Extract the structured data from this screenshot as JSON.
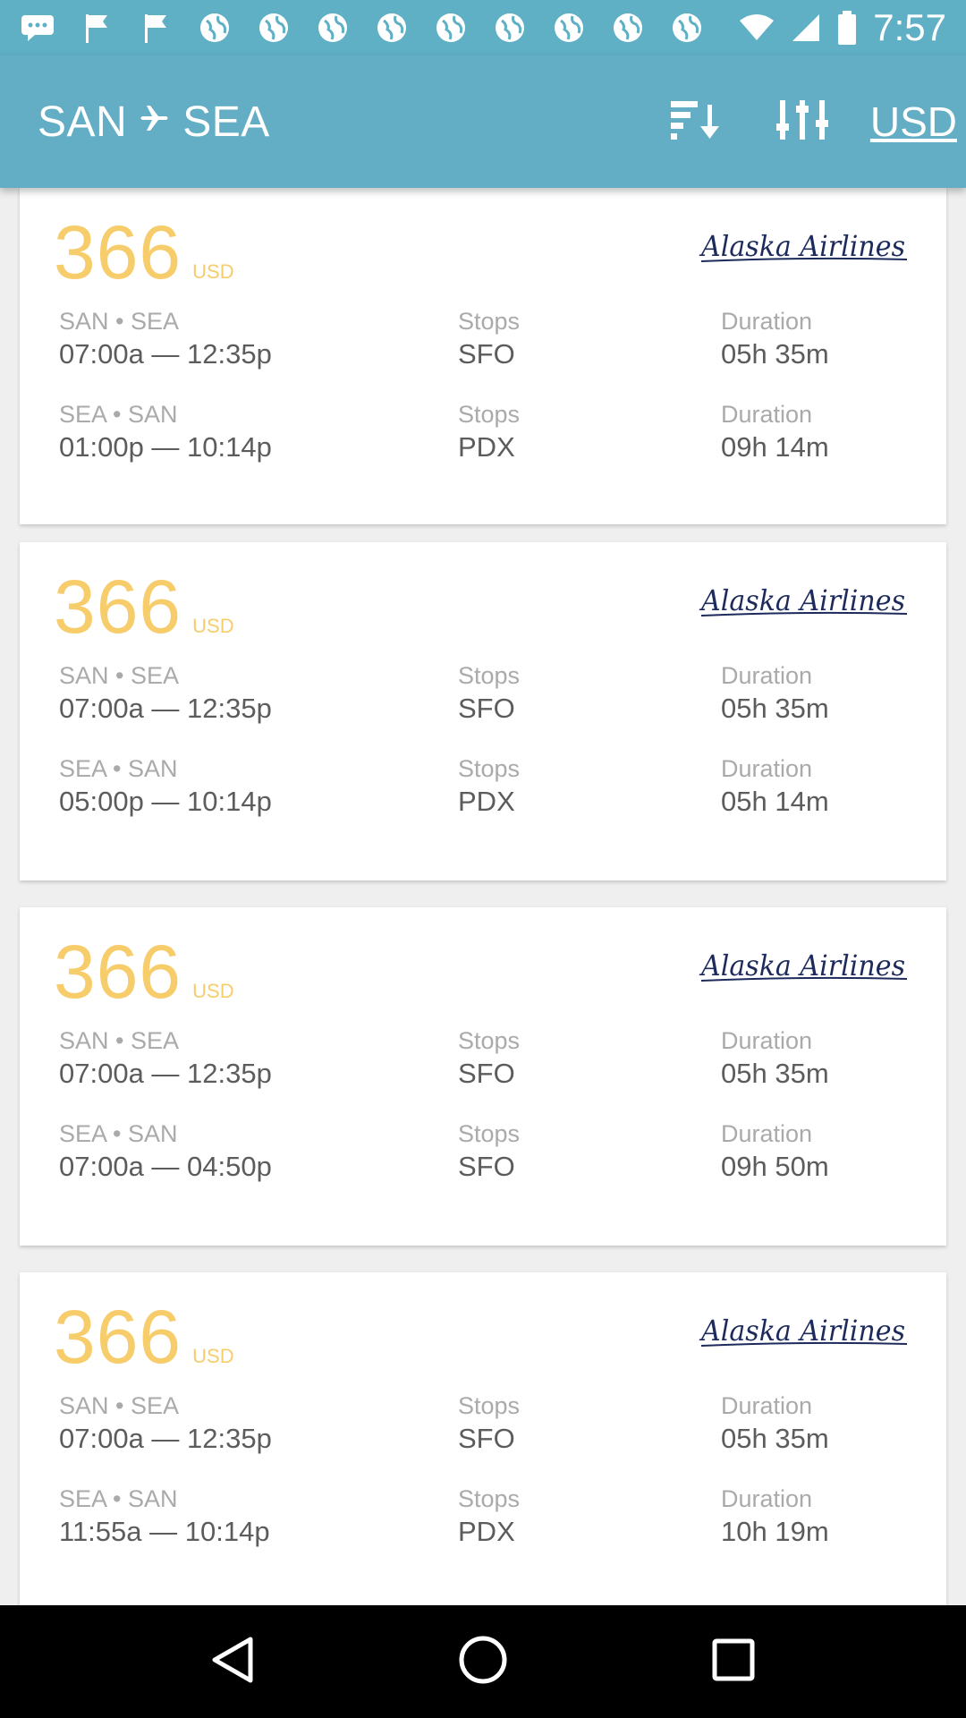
{
  "status_bar": {
    "time": "7:57",
    "notification_icons": [
      "chat-icon",
      "flag-icon",
      "flag-icon",
      "globe-icon",
      "globe-icon",
      "globe-icon",
      "globe-icon",
      "globe-icon",
      "globe-icon",
      "globe-icon",
      "globe-icon"
    ],
    "colors": {
      "background": "#5fb0c5"
    }
  },
  "header": {
    "origin": "SAN",
    "destination": "SEA",
    "sort_icon": "sort-icon",
    "filter_icon": "filter-icon",
    "currency": "USD",
    "colors": {
      "background": "#63aec4"
    }
  },
  "results": [
    {
      "price": "366",
      "currency": "USD",
      "airline": "Alaska Airlines",
      "outbound": {
        "route": "SAN • SEA",
        "times": "07:00a — 12:35p",
        "stops_label": "Stops",
        "stops": "SFO",
        "duration_label": "Duration",
        "duration": "05h 35m"
      },
      "return": {
        "route": "SEA • SAN",
        "times": "01:00p — 10:14p",
        "stops_label": "Stops",
        "stops": "PDX",
        "duration_label": "Duration",
        "duration": "09h 14m"
      }
    },
    {
      "price": "366",
      "currency": "USD",
      "airline": "Alaska Airlines",
      "outbound": {
        "route": "SAN • SEA",
        "times": "07:00a — 12:35p",
        "stops_label": "Stops",
        "stops": "SFO",
        "duration_label": "Duration",
        "duration": "05h 35m"
      },
      "return": {
        "route": "SEA • SAN",
        "times": "05:00p — 10:14p",
        "stops_label": "Stops",
        "stops": "PDX",
        "duration_label": "Duration",
        "duration": "05h 14m"
      }
    },
    {
      "price": "366",
      "currency": "USD",
      "airline": "Alaska Airlines",
      "outbound": {
        "route": "SAN • SEA",
        "times": "07:00a — 12:35p",
        "stops_label": "Stops",
        "stops": "SFO",
        "duration_label": "Duration",
        "duration": "05h 35m"
      },
      "return": {
        "route": "SEA • SAN",
        "times": "07:00a — 04:50p",
        "stops_label": "Stops",
        "stops": "SFO",
        "duration_label": "Duration",
        "duration": "09h 50m"
      }
    },
    {
      "price": "366",
      "currency": "USD",
      "airline": "Alaska Airlines",
      "outbound": {
        "route": "SAN • SEA",
        "times": "07:00a — 12:35p",
        "stops_label": "Stops",
        "stops": "SFO",
        "duration_label": "Duration",
        "duration": "05h 35m"
      },
      "return": {
        "route": "SEA • SAN",
        "times": "11:55a — 10:14p",
        "stops_label": "Stops",
        "stops": "PDX",
        "duration_label": "Duration",
        "duration": "10h 19m"
      }
    }
  ],
  "theme": {
    "price_color": "#f7cc6a",
    "airline_logo_color": "#1d2b5c"
  },
  "nav_bar": {
    "back_icon": "back-triangle-icon",
    "home_icon": "home-circle-icon",
    "recents_icon": "recents-square-icon"
  }
}
